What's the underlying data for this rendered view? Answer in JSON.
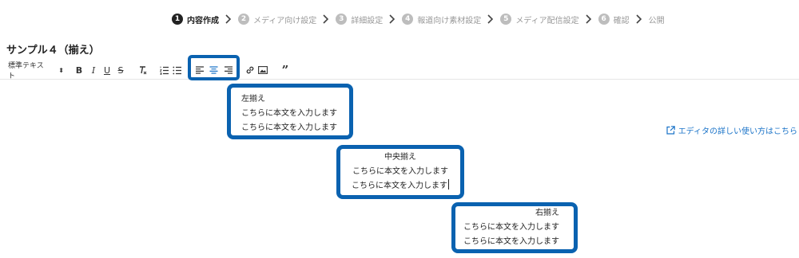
{
  "stepper": {
    "steps": [
      {
        "num": "1",
        "label": "内容作成"
      },
      {
        "num": "2",
        "label": "メディア向け設定"
      },
      {
        "num": "3",
        "label": "詳細設定"
      },
      {
        "num": "4",
        "label": "報道向け素材設定"
      },
      {
        "num": "5",
        "label": "メディア配信設定"
      },
      {
        "num": "6",
        "label": "確認"
      },
      {
        "num": "",
        "label": "公開"
      }
    ],
    "active_index": 0
  },
  "page_title": "サンプル４（揃え）",
  "toolbar": {
    "format_select": "標準テキスト",
    "format_arrow": "⬍",
    "bold": "B",
    "italic": "I",
    "underline": "U",
    "strike": "S",
    "clear": "T",
    "quote": "”"
  },
  "help_link": "エディタの詳しい使い方はこちら",
  "content": {
    "left": [
      "左揃え",
      "こちらに本文を入力します",
      "こちらに本文を入力します"
    ],
    "center": [
      "中央揃え",
      "こちらに本文を入力します",
      "こちらに本文を入力します"
    ],
    "right": [
      "右揃え",
      "こちらに本文を入力します",
      "こちらに本文を入力します"
    ]
  },
  "colors": {
    "highlight": "#0a62b0",
    "link": "#1a73c8"
  }
}
